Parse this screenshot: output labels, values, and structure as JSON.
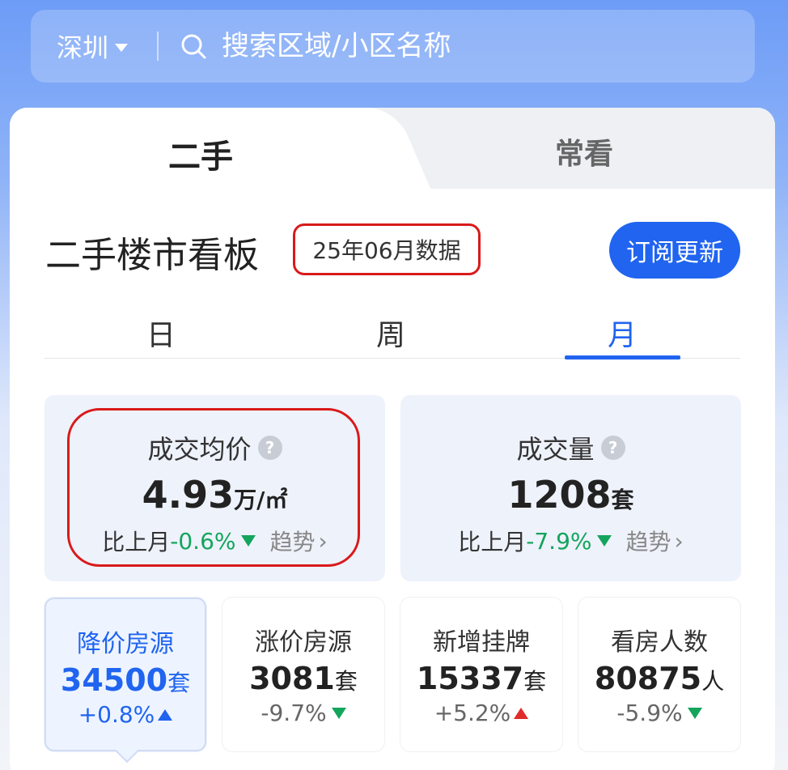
{
  "search": {
    "city": "深圳",
    "placeholder": "搜索区域/小区名称"
  },
  "top_tabs": [
    {
      "label": "二手",
      "active": true
    },
    {
      "label": "常看",
      "active": false
    }
  ],
  "board": {
    "title": "二手楼市看板",
    "date_badge": "25年06月数据",
    "subscribe_label": "订阅更新"
  },
  "period_tabs": [
    {
      "label": "日"
    },
    {
      "label": "周"
    },
    {
      "label": "月",
      "active": true
    }
  ],
  "stats": {
    "avg_price": {
      "label": "成交均价",
      "value": "4.93",
      "unit": "万/㎡",
      "compare_label": "比上月",
      "change": "-0.6%",
      "trend_label": "趋势"
    },
    "volume": {
      "label": "成交量",
      "value": "1208",
      "unit": "套",
      "compare_label": "比上月",
      "change": "-7.9%",
      "trend_label": "趋势"
    }
  },
  "mini_stats": [
    {
      "label": "降价房源",
      "value": "34500",
      "unit": "套",
      "change": "+0.8%",
      "direction": "up",
      "active": true
    },
    {
      "label": "涨价房源",
      "value": "3081",
      "unit": "套",
      "change": "-9.7%",
      "direction": "down"
    },
    {
      "label": "新增挂牌",
      "value": "15337",
      "unit": "套",
      "change": "+5.2%",
      "direction": "up"
    },
    {
      "label": "看房人数",
      "value": "80875",
      "unit": "人",
      "change": "-5.9%",
      "direction": "down"
    }
  ],
  "colors": {
    "accent": "#2064f0",
    "down": "#13a55c",
    "up": "#e02b2b",
    "highlight": "#d91a1a"
  }
}
